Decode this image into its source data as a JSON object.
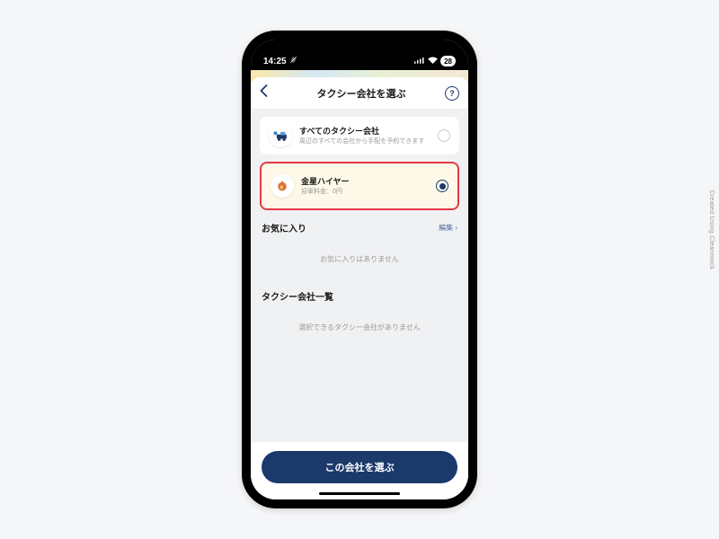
{
  "status": {
    "time": "14:25",
    "battery": "28"
  },
  "nav": {
    "title": "タクシー会社を選ぶ"
  },
  "companies": {
    "all": {
      "name": "すべてのタクシー会社",
      "desc": "周辺のすべての会社から手配を予約できます"
    },
    "selected": {
      "name": "金星ハイヤー",
      "desc": "迎車料金：0円"
    }
  },
  "sections": {
    "favorites": {
      "title": "お気に入り",
      "edit": "編集",
      "empty": "お気に入りはありません"
    },
    "list": {
      "title": "タクシー会社一覧",
      "empty": "選択できるタクシー会社がありません"
    }
  },
  "confirm": "この会社を選ぶ",
  "credit": "Created Using Cleanmock"
}
